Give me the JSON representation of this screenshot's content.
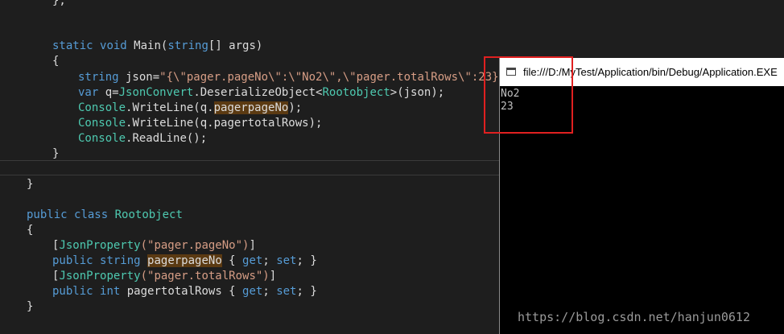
{
  "editor": {
    "top_fragment": "},",
    "method_signature": {
      "static": "static",
      "void": "void",
      "name": " Main(",
      "string": "string",
      "rest": "[] args)"
    },
    "open_brace": "{",
    "json_line": {
      "keyword": "string",
      "mid": " json=",
      "literal": "\"{\\\"pager.pageNo\\\":\\\"No2\\\",\\\"pager.totalRows\\\":23}\";"
    },
    "deserialize_line": {
      "var": "var",
      "mid": " q=",
      "class": "JsonConvert",
      "method": ".DeserializeObject<",
      "type": "Rootobject",
      "rest": ">(json);"
    },
    "writeline1": {
      "console": "Console",
      "pre": ".WriteLine(q.",
      "member": "pagerpageNo",
      "post": ");"
    },
    "writeline2": {
      "console": "Console",
      "rest": ".WriteLine(q.pagertotalRows);"
    },
    "readline": {
      "console": "Console",
      "rest": ".ReadLine();"
    },
    "close_brace_method": "}",
    "close_brace_class": "}",
    "class_decl": {
      "public": "public",
      "class": "class",
      "name": " Rootobject"
    },
    "class_open": "{",
    "attr1": {
      "open": "[",
      "name": "JsonProperty",
      "literal": "(\"pager.pageNo\")",
      "close": "]"
    },
    "prop1": {
      "public": "public",
      "string": "string",
      "name": "pagerpageNo",
      "get": "get",
      "set": "set"
    },
    "attr2": {
      "open": "[",
      "name": "JsonProperty",
      "literal": "(\"pager.totalRows\")",
      "close": "]"
    },
    "prop2": {
      "public": "public",
      "int": "int",
      "name": " pagertotalRows { ",
      "get": "get",
      "set": "set"
    },
    "class_close": "}"
  },
  "console_window": {
    "title": "file:///D:/MyTest/Application/bin/Debug/Application.EXE",
    "output": [
      "No2",
      "23"
    ]
  },
  "watermark": "https://blog.csdn.net/hanjun0612"
}
